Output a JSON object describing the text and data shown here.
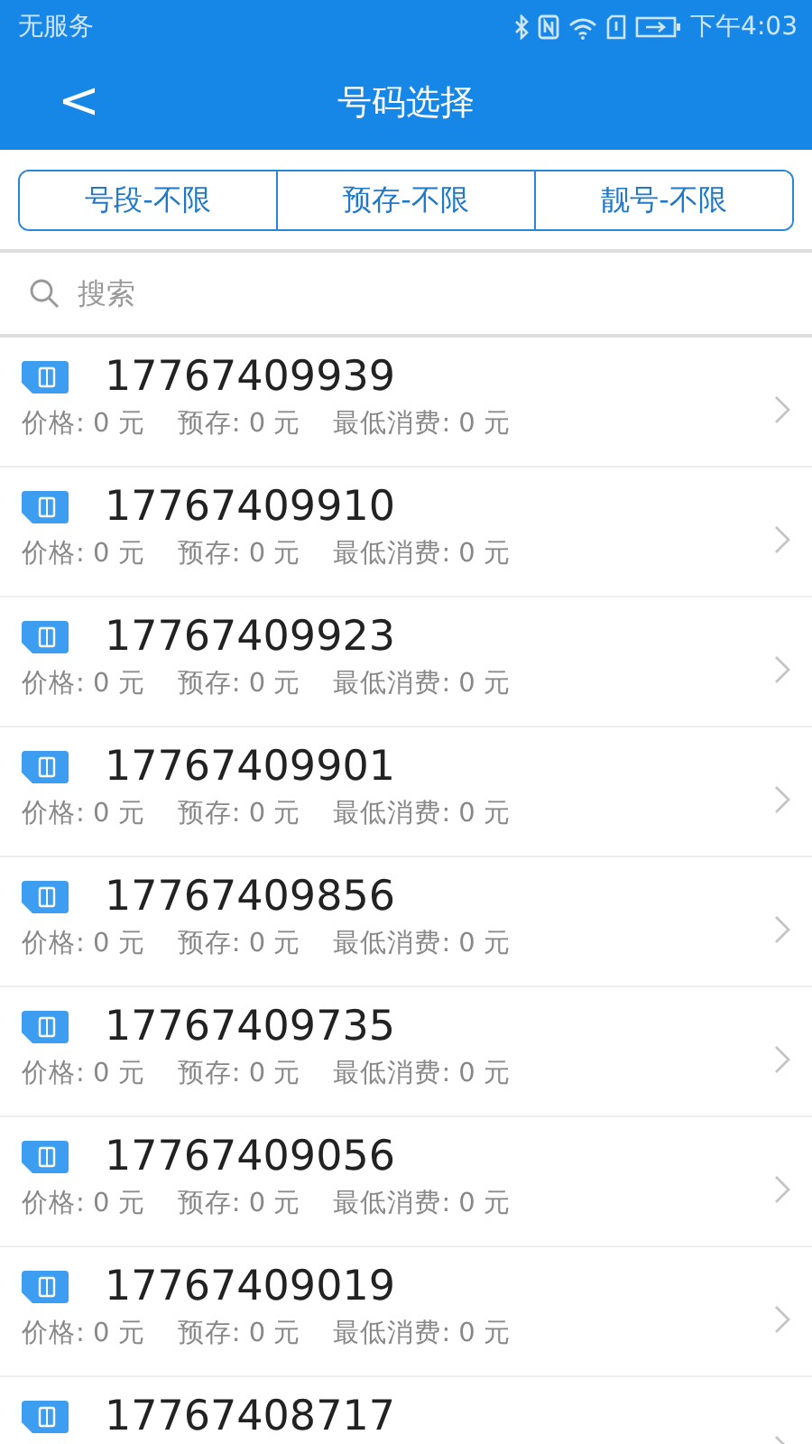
{
  "status_bar": {
    "carrier": "无服务",
    "time": "下午4:03"
  },
  "header": {
    "back": "<",
    "title": "号码选择"
  },
  "filters": [
    {
      "label": "号段-不限"
    },
    {
      "label": "预存-不限"
    },
    {
      "label": "靓号-不限"
    }
  ],
  "search": {
    "placeholder": "搜索"
  },
  "numbers": [
    {
      "number": "17767409939",
      "details": [
        "价格: 0 元",
        "预存: 0 元",
        "最低消费: 0 元"
      ]
    },
    {
      "number": "17767409910",
      "details": [
        "价格: 0 元",
        "预存: 0 元",
        "最低消费: 0 元"
      ]
    },
    {
      "number": "17767409923",
      "details": [
        "价格: 0 元",
        "预存: 0 元",
        "最低消费: 0 元"
      ]
    },
    {
      "number": "17767409901",
      "details": [
        "价格: 0 元",
        "预存: 0 元",
        "最低消费: 0 元"
      ]
    },
    {
      "number": "17767409856",
      "details": [
        "价格: 0 元",
        "预存: 0 元",
        "最低消费: 0 元"
      ]
    },
    {
      "number": "17767409735",
      "details": [
        "价格: 0 元",
        "预存: 0 元",
        "最低消费: 0 元"
      ]
    },
    {
      "number": "17767409056",
      "details": [
        "价格: 0 元",
        "预存: 0 元",
        "最低消费: 0 元"
      ]
    },
    {
      "number": "17767409019",
      "details": [
        "价格: 0 元",
        "预存: 0 元",
        "最低消费: 0 元"
      ]
    },
    {
      "number": "17767408717"
    }
  ]
}
